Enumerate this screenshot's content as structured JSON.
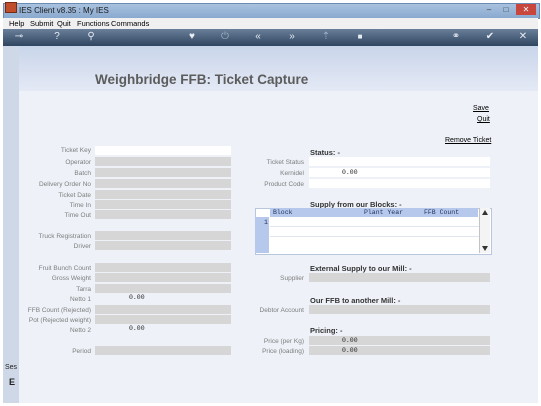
{
  "window": {
    "title": "IES Client v8.35 : My IES",
    "controls": [
      "–",
      "□",
      "✕"
    ]
  },
  "menu": [
    "Help",
    "Submit",
    "Quit",
    "Functions",
    "Commands"
  ],
  "toolbar": {
    "icons": [
      "key-icon",
      "help-icon",
      "search-icon",
      "heart-icon",
      "power-icon",
      "rewind-icon",
      "fast-forward-icon",
      "upload-icon",
      "stop-icon",
      "link-icon",
      "check-icon",
      "close-icon"
    ],
    "glyphs": [
      "⊸",
      "?",
      "⚲",
      "♥",
      "⏻",
      "«",
      "»",
      "⇡",
      "■",
      "⚭",
      "✔",
      "✕"
    ]
  },
  "page": {
    "title": "Weighbridge FFB: Ticket Capture",
    "links": {
      "save": "Save",
      "quit": "Quit",
      "remove": "Remove Ticket"
    }
  },
  "left": {
    "ticket_key": "Ticket Key",
    "operator": "Operator",
    "batch": "Batch",
    "delivery_order_no": "Delivery Order No",
    "ticket_date": "Ticket Date",
    "time_in": "Time In",
    "time_out": "Time Out",
    "truck_registration": "Truck Registration",
    "driver": "Driver",
    "fruit_bunch_count": "Fruit Bunch Count",
    "gross_weight": "Gross Weight",
    "tarra": "Tarra",
    "netto1": "Netto 1",
    "netto1_value": "0.00",
    "ffb_count_rejected": "FFB Count (Rejected)",
    "pot_rejected_weight": "Pot (Rejected weight)",
    "netto2": "Netto 2",
    "netto2_value": "0.00",
    "period": "Period"
  },
  "status": {
    "heading": "Status: -",
    "ticket_status": "Ticket Status",
    "kernidel": "Kernidel",
    "kernidel_value": "0.00",
    "product_code": "Product Code"
  },
  "supply_blocks": {
    "heading": "Supply from our Blocks: -",
    "columns": [
      "Block",
      "Plant Year",
      "FFB Count"
    ],
    "row_number": "1"
  },
  "external_supply": {
    "heading": "External Supply to our Mill: -",
    "supplier": "Supplier"
  },
  "ffb_other_mill": {
    "heading": "Our FFB to another Mill: -",
    "debtor_account": "Debtor Account"
  },
  "pricing": {
    "heading": "Pricing: -",
    "price_per_kg": "Price (per Kg)",
    "price_per_kg_value": "0.00",
    "price_loading": "Price (loading)",
    "price_loading_value": "0.00"
  },
  "bottom_strip": {
    "text1": "Ses",
    "text2": "E"
  }
}
